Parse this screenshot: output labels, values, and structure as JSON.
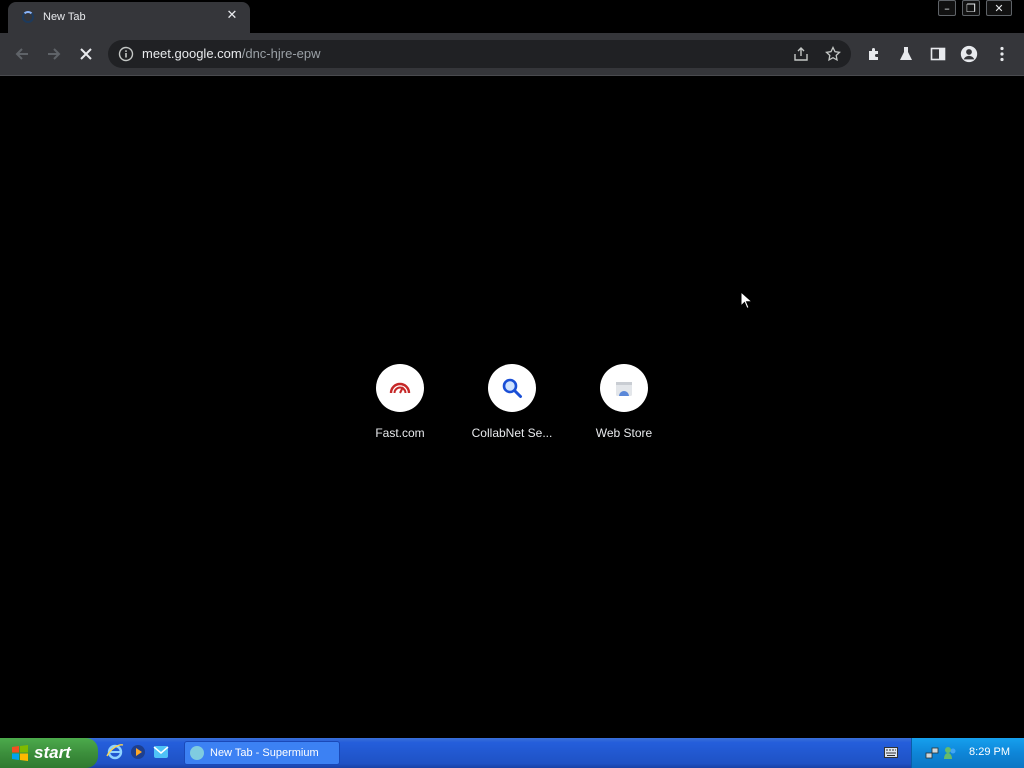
{
  "tab": {
    "title": "New Tab"
  },
  "window_controls": {
    "minimize": "–",
    "restore": "❐",
    "close": "✕"
  },
  "toolbar": {
    "url_host": "meet.google.com",
    "url_path": "/dnc-hjre-epw"
  },
  "shortcuts": [
    {
      "label": "Fast.com",
      "icon": "speedometer-icon"
    },
    {
      "label": "CollabNet Se...",
      "icon": "magnifier-icon"
    },
    {
      "label": "Web Store",
      "icon": "web-store-icon"
    }
  ],
  "taskbar": {
    "start_label": "start",
    "task_label": "New Tab - Supermium",
    "clock": "8:29 PM"
  },
  "colors": {
    "page_background": "#000000",
    "toolbar": "#35363a",
    "omnibox": "#202124",
    "taskbar": "#245edb",
    "start_button": "#3c8f3c"
  }
}
